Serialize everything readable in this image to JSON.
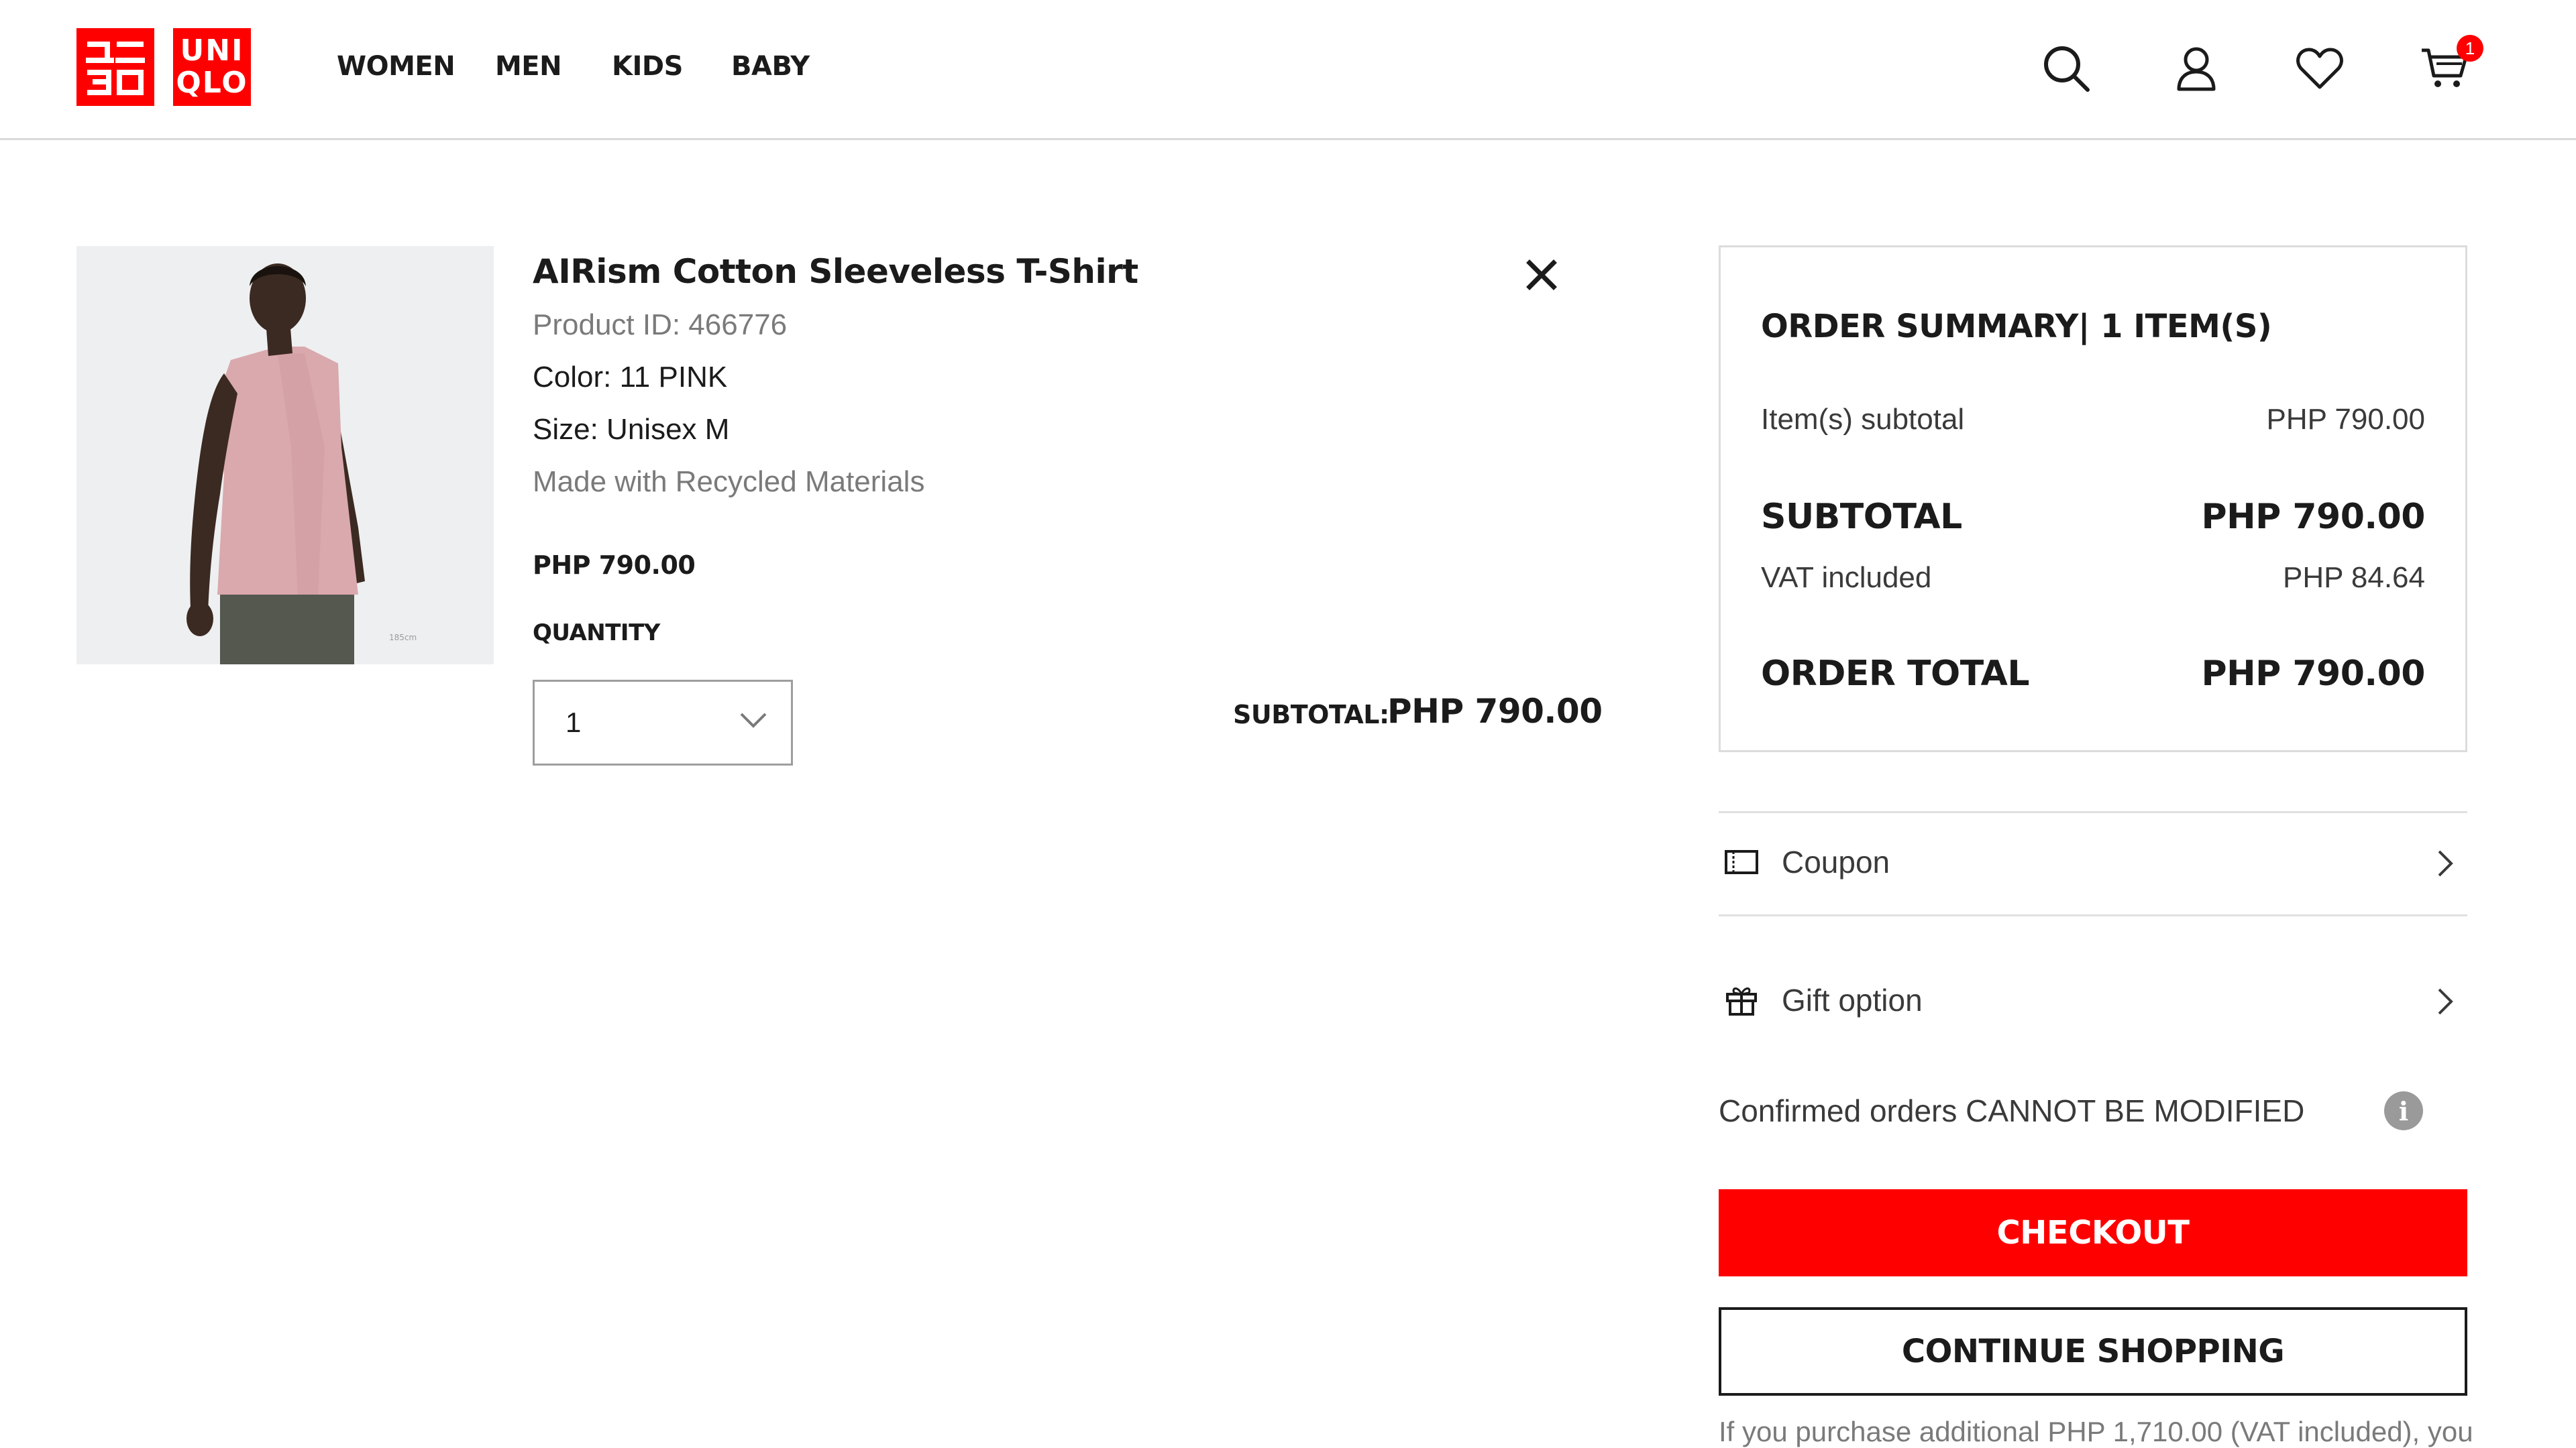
{
  "brand": {
    "logo_top": "ユニ",
    "logo_bottom": "クロ",
    "logo_en_top": "UNI",
    "logo_en_bottom": "QLO",
    "color": "#ff0000"
  },
  "nav": {
    "items": [
      "WOMEN",
      "MEN",
      "KIDS",
      "BABY"
    ]
  },
  "header_icons": [
    "search-icon",
    "account-icon",
    "wishlist-heart-icon",
    "cart-icon"
  ],
  "cart": {
    "badge_count": "1"
  },
  "product": {
    "name": "AIRism Cotton Sleeveless T-Shirt",
    "product_id": "Product ID: 466776",
    "color": "Color: 11 PINK",
    "size": "Size: Unisex M",
    "material_note": "Made with Recycled Materials",
    "price": "PHP 790.00",
    "quantity_label": "QUANTITY",
    "quantity_value": "1",
    "subtotal_label": "SUBTOTAL:",
    "subtotal_value": "PHP 790.00"
  },
  "summary": {
    "title": "ORDER SUMMARY| 1 ITEM(S)",
    "items_subtotal_label": "Item(s) subtotal",
    "items_subtotal_value": "PHP 790.00",
    "subtotal_label": "SUBTOTAL",
    "subtotal_value": "PHP 790.00",
    "vat_label": "VAT included",
    "vat_value": "PHP 84.64",
    "total_label": "ORDER TOTAL",
    "total_value": "PHP 790.00"
  },
  "options": {
    "coupon_label": "Coupon",
    "gift_label": "Gift option"
  },
  "notice": "Confirmed orders CANNOT BE MODIFIED",
  "buttons": {
    "checkout": "CHECKOUT",
    "continue": "CONTINUE SHOPPING"
  },
  "footer_note": "If you purchase additional PHP 1,710.00 (VAT included), you"
}
